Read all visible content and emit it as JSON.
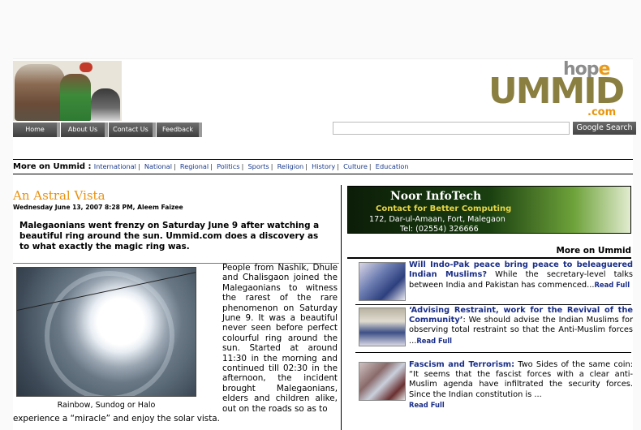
{
  "header": {
    "logo": {
      "hope": "hop",
      "hope_e": "e",
      "ummid": "UMMID",
      "com": ".com"
    },
    "nav": [
      {
        "label": "Home"
      },
      {
        "label": "About Us"
      },
      {
        "label": "Contact Us"
      },
      {
        "label": "Feedback"
      }
    ],
    "search": {
      "value": "",
      "button_label": "Google Search"
    }
  },
  "more_bar": {
    "label": "More on Ummid :",
    "links": [
      "International",
      "National",
      "Regional",
      "Politics",
      "Sports",
      "Religion",
      "History",
      "Culture",
      "Education"
    ]
  },
  "article": {
    "title": "An Astral Vista",
    "dateline": "Wednesday June 13, 2007 8:28 PM, Aleem Faizee",
    "lead": "Malegaonians went frenzy on Saturday June 9 after watching a beautiful ring around the sun. Ummid.com does a discovery as to what exactly the magic ring was.",
    "caption": "Rainbow, Sundog or Halo",
    "body": "People from Nashik, Dhule and Chalisgaon joined the Malegaonians to witness the rarest of the rare phenomenon on Saturday June 9. It was a beautiful never seen before perfect colourful ring around the sun. Started at around 11:30 in the morning and continued till 02:30 in the afternoon, the incident brought Malegaonians, elders and children alike, out on the roads so as to",
    "tail": "experience a “miracle” and enjoy the solar vista."
  },
  "ad": {
    "title": "Noor InfoTech",
    "subtitle": "Contact for Better Computing",
    "address": "172, Dar-ul-Amaan, Fort, Malegaon",
    "tel": "Tel: (02554) 326666"
  },
  "sidebar": {
    "heading": "More on Ummid",
    "stories": [
      {
        "headline": "Will Indo-Pak peace bring peace to beleaguered Indian Muslims?",
        "snippet": " While the secretary-level talks between India and Pakistan has commenced...",
        "read_full": "Read Full"
      },
      {
        "headline": "‘Advising Restraint, work for the Revival of the Community’",
        "snippet": ": We should advise the Indian Muslims for observing total restraint so that the Anti-Muslim forces ...",
        "read_full": "Read Full"
      },
      {
        "headline": "Fascism and Terrorism:",
        "snippet": " Two Sides of the same coin: “It seems that the fascist forces with a clear anti-Muslim agenda have infiltrated the security forces. Since the Indian constitution is ...",
        "read_full": "Read Full"
      }
    ]
  }
}
